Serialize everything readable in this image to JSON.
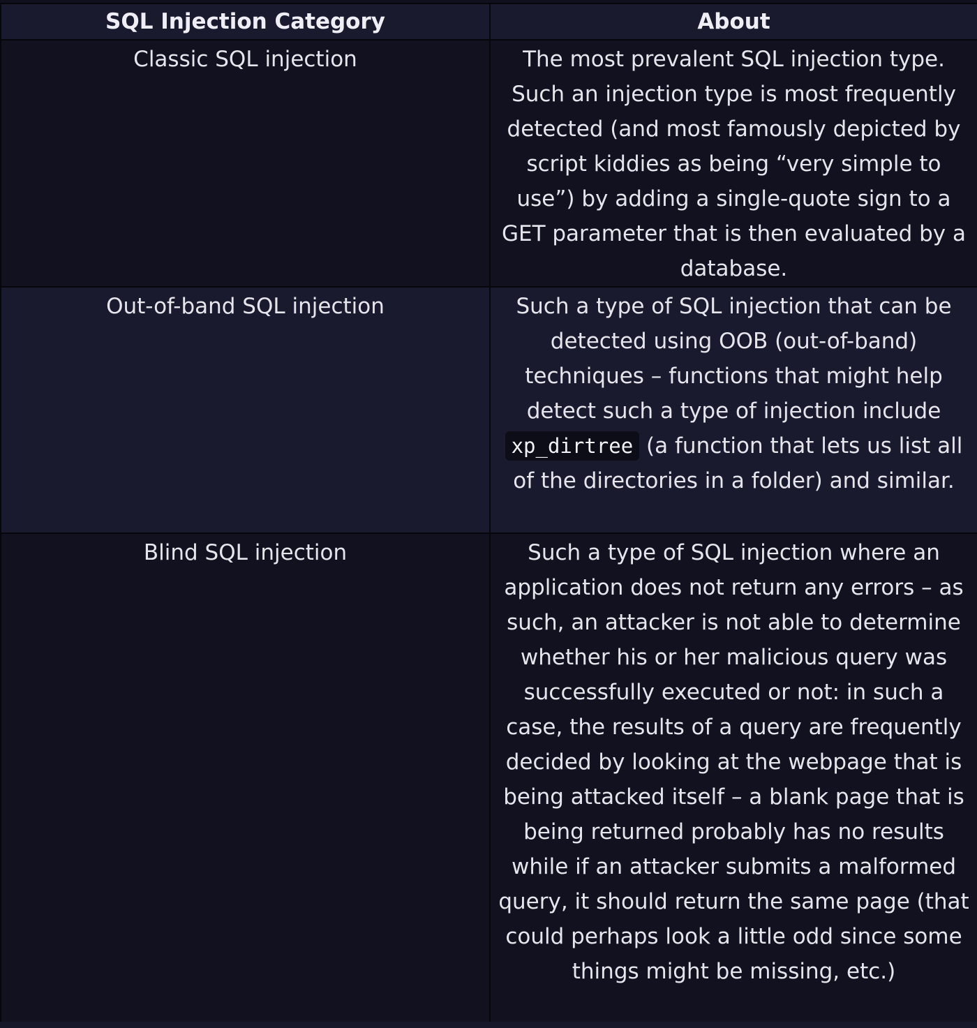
{
  "table": {
    "headers": [
      "SQL Injection Category",
      "About"
    ],
    "rows": [
      {
        "category": "Classic SQL injection",
        "about": "The most prevalent SQL injection type. Such an injection type is most frequently detected (and most famously depicted by script kiddies as being “very simple to use”) by adding a single-quote sign to a GET parameter that is then evaluated by a database."
      },
      {
        "category": "Out-of-band SQL injection",
        "about_before_code": "Such a type of SQL injection that can be detected using OOB (out-of-band) techniques – functions that might help detect such a type of injection include ",
        "about_code": "xp_dirtree",
        "about_after_code": " (a function that lets us list all of the directories in a folder) and similar."
      },
      {
        "category": "Blind SQL injection",
        "about": "Such a type of SQL injection where an application does not return any errors – as such, an attacker is not able to determine whether his or her malicious query was successfully executed or not: in such a case, the results of a query are frequently decided by looking at the webpage that is being attacked itself – a blank page that is being returned probably has no results while if an attacker submits a malformed query, it should return the same page (that could perhaps look a little odd since some things might be missing, etc.)"
      }
    ]
  },
  "colors": {
    "page_background": "#0f0f1d",
    "header_background": "#1a1a2f",
    "row_background_dark": "#11111f",
    "row_background_light": "#1a1a2e",
    "border": "#06060d",
    "text": "#e6e5ec"
  }
}
